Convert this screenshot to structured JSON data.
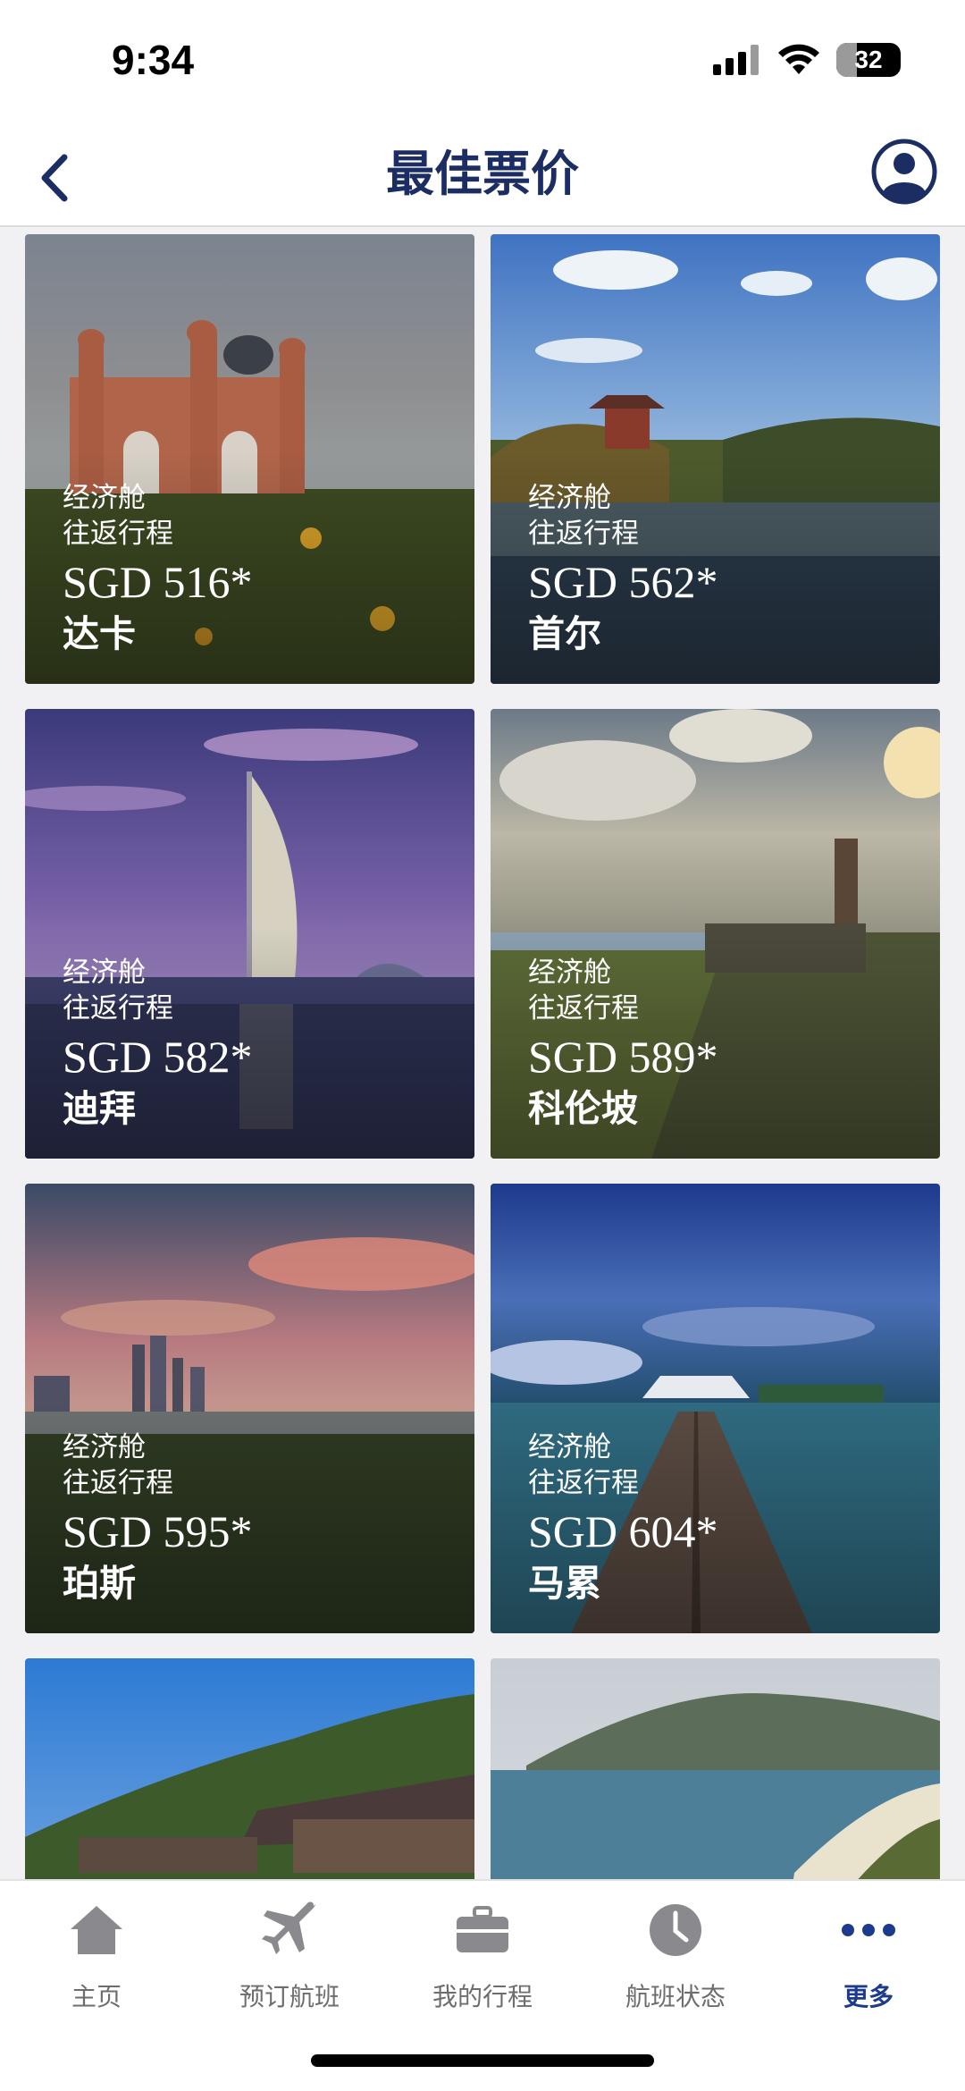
{
  "status_bar": {
    "time": "9:34",
    "battery": "32",
    "battery_level_percent": 32
  },
  "header": {
    "title": "最佳票价"
  },
  "deals": [
    {
      "cabin": "经济舱",
      "trip": "往返行程",
      "price": "SGD 516*",
      "city": "达卡"
    },
    {
      "cabin": "经济舱",
      "trip": "往返行程",
      "price": "SGD 562*",
      "city": "首尔"
    },
    {
      "cabin": "经济舱",
      "trip": "往返行程",
      "price": "SGD 582*",
      "city": "迪拜"
    },
    {
      "cabin": "经济舱",
      "trip": "往返行程",
      "price": "SGD 589*",
      "city": "科伦坡"
    },
    {
      "cabin": "经济舱",
      "trip": "往返行程",
      "price": "SGD 595*",
      "city": "珀斯"
    },
    {
      "cabin": "经济舱",
      "trip": "往返行程",
      "price": "SGD 604*",
      "city": "马累"
    }
  ],
  "tabs": [
    {
      "label": "主页",
      "icon": "home-icon"
    },
    {
      "label": "预订航班",
      "icon": "airplane-icon"
    },
    {
      "label": "我的行程",
      "icon": "briefcase-icon"
    },
    {
      "label": "航班状态",
      "icon": "clock-icon"
    },
    {
      "label": "更多",
      "icon": "more-dots-icon",
      "active": true
    }
  ],
  "colors": {
    "brand": "#1b2d63",
    "active_tab": "#1e3a8c",
    "inactive_tab": "#6d6d6d"
  }
}
